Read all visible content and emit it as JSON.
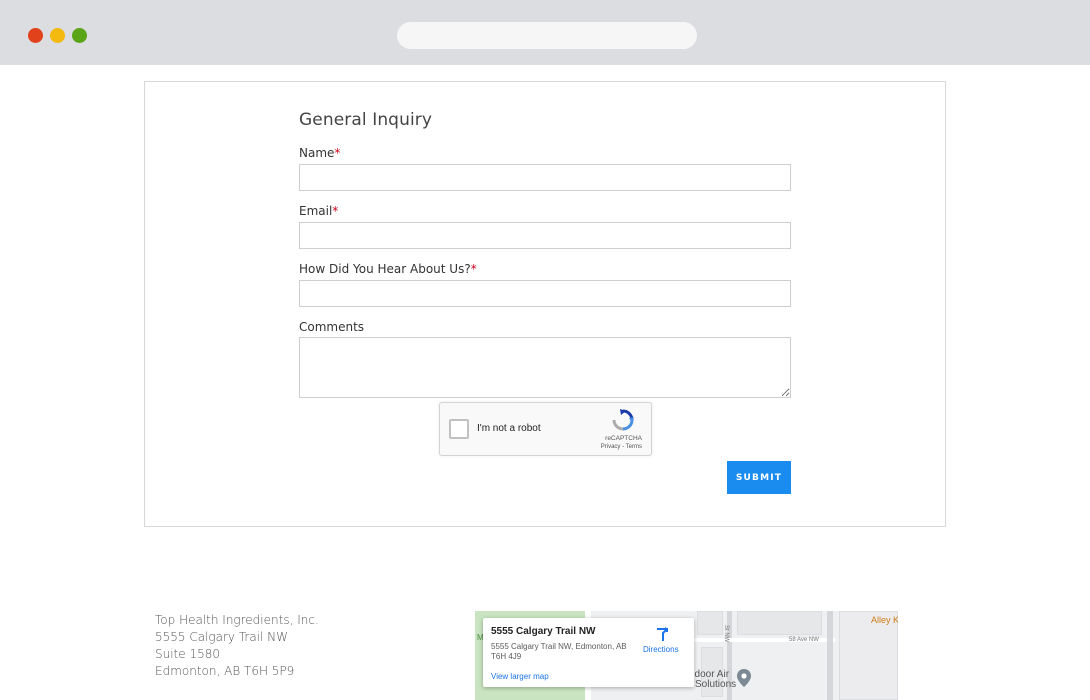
{
  "form": {
    "title": "General Inquiry",
    "fields": [
      {
        "label": "Name",
        "required_mark": "*",
        "value": ""
      },
      {
        "label": "Email",
        "required_mark": "*",
        "value": ""
      },
      {
        "label": "How Did You Hear About Us?",
        "required_mark": "*",
        "value": ""
      },
      {
        "label": "Comments",
        "required_mark": "",
        "value": ""
      }
    ],
    "captcha": {
      "label": "I'm not a robot",
      "brand": "reCAPTCHA",
      "links": "Privacy - Terms",
      "checked": false
    },
    "submit_label": "SUBMIT"
  },
  "address": {
    "lines": [
      "Top Health Ingredients, Inc.",
      "5555 Calgary Trail NW",
      "Suite 1580",
      "Edmonton, AB  T6H 5P9"
    ]
  },
  "map": {
    "card_title": "5555 Calgary Trail NW",
    "card_address": "5555 Calgary Trail NW, Edmonton, AB T6H 4J9",
    "view_larger": "View larger map",
    "directions": "Directions",
    "labels": {
      "street_1": "58 Ave NW",
      "street_2": "St NW",
      "business": "ndoor Air",
      "business_2": "Solutions",
      "alley": "Alley K",
      "park_letter": "M"
    }
  },
  "colors": {
    "accent": "#1a8cf0",
    "required": "#d0021b",
    "map_link": "#1a73e8"
  }
}
